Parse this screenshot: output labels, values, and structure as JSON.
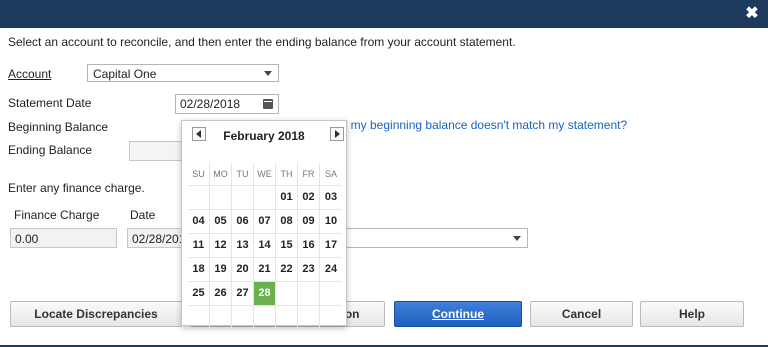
{
  "window": {
    "close_symbol": "✖"
  },
  "instruction": "Select an account to reconcile, and then enter the ending balance from your account statement.",
  "account": {
    "label": "Account",
    "value": "Capital One"
  },
  "statement_date": {
    "label": "Statement Date",
    "value": "02/28/2018"
  },
  "beginning_balance": {
    "label": "Beginning Balance"
  },
  "ending_balance": {
    "label": "Ending Balance"
  },
  "help_link": "What if my beginning balance doesn't match my statement?",
  "finance": {
    "heading": "Enter any finance charge.",
    "charge_label": "Finance Charge",
    "charge_value": "0.00",
    "date_label": "Date",
    "date_value": "02/28/2018"
  },
  "buttons": {
    "locate": "Locate Discrepancies",
    "undo": "Undo Last Reconciliation",
    "continue": "Continue",
    "cancel": "Cancel",
    "help": "Help"
  },
  "calendar": {
    "month": "February 2018",
    "weekdays": [
      "SU",
      "MO",
      "TU",
      "WE",
      "TH",
      "FR",
      "SA"
    ],
    "weeks": [
      [
        "",
        "",
        "",
        "",
        "01",
        "02",
        "03"
      ],
      [
        "04",
        "05",
        "06",
        "07",
        "08",
        "09",
        "10"
      ],
      [
        "11",
        "12",
        "13",
        "14",
        "15",
        "16",
        "17"
      ],
      [
        "18",
        "19",
        "20",
        "21",
        "22",
        "23",
        "24"
      ],
      [
        "25",
        "26",
        "27",
        "28",
        "",
        "",
        ""
      ],
      [
        "",
        "",
        "",
        "",
        "",
        "",
        ""
      ]
    ],
    "selected": "28",
    "selected_color": "#6ab04c"
  },
  "colors": {
    "titlebar": "#1d3a5c",
    "link": "#1565c0",
    "primary_button": "#2a6ccf"
  }
}
